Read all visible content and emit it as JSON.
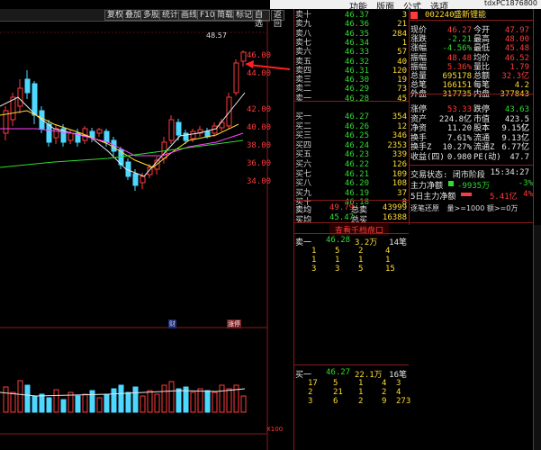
{
  "menu": {
    "items": [
      "功能",
      "版面",
      "公式",
      "选项"
    ],
    "device_id": "tdxPC1876800"
  },
  "toolbar": {
    "buttons": [
      "复权",
      "叠加",
      "多股",
      "统计",
      "画线",
      "F10",
      "简载",
      "标记",
      "自选",
      "返回"
    ]
  },
  "chart": {
    "price_labels": [
      "46.00",
      "44.00",
      "42.00",
      "40.00",
      "38.00",
      "36.00",
      "34.00"
    ],
    "high_marker": "48.57",
    "markers": [
      "财",
      "涨停"
    ],
    "volume_unit": "X100",
    "colors": {
      "up": "#ff3b3b",
      "down": "#4fd8ff",
      "ma5": "#e8e8e8",
      "ma10": "#ffdd33",
      "ma20": "#ff44ff",
      "ma60": "#2fdc2f"
    }
  },
  "orderbook": {
    "asks": [
      {
        "label": "卖十",
        "price": "46.37",
        "vol": "3"
      },
      {
        "label": "卖九",
        "price": "46.36",
        "vol": "21"
      },
      {
        "label": "卖八",
        "price": "46.35",
        "vol": "284"
      },
      {
        "label": "卖七",
        "price": "46.34",
        "vol": "1"
      },
      {
        "label": "卖六",
        "price": "46.33",
        "vol": "57"
      },
      {
        "label": "卖五",
        "price": "46.32",
        "vol": "40"
      },
      {
        "label": "卖四",
        "price": "46.31",
        "vol": "120"
      },
      {
        "label": "卖三",
        "price": "46.30",
        "vol": "19"
      },
      {
        "label": "卖二",
        "price": "46.29",
        "vol": "73"
      },
      {
        "label": "卖一",
        "price": "46.28",
        "vol": "45"
      }
    ],
    "bids": [
      {
        "label": "买一",
        "price": "46.27",
        "vol": "354"
      },
      {
        "label": "买二",
        "price": "46.26",
        "vol": "12"
      },
      {
        "label": "买三",
        "price": "46.25",
        "vol": "346"
      },
      {
        "label": "买四",
        "price": "46.24",
        "vol": "2353"
      },
      {
        "label": "买五",
        "price": "46.23",
        "vol": "339"
      },
      {
        "label": "买六",
        "price": "46.22",
        "vol": "126"
      },
      {
        "label": "买七",
        "price": "46.21",
        "vol": "109"
      },
      {
        "label": "买八",
        "price": "46.20",
        "vol": "108"
      },
      {
        "label": "买九",
        "price": "46.19",
        "vol": "37"
      },
      {
        "label": "买十",
        "price": "46.18",
        "vol": "8"
      }
    ],
    "avg_sell": {
      "label": "卖均",
      "price": "49.79",
      "total_label": "总卖",
      "total": "43999"
    },
    "avg_buy": {
      "label": "买均",
      "price": "45.47",
      "total_label": "总买",
      "total": "16388"
    }
  },
  "quote": {
    "code": "002240",
    "name": "盛新锂能",
    "rows": [
      {
        "l1": "现价",
        "v1": "46.27",
        "l2": "今开",
        "v2": "47.97"
      },
      {
        "l1": "涨跌",
        "v1": "-2.21",
        "l2": "最高",
        "v2": "48.00"
      },
      {
        "l1": "涨幅",
        "v1": "-4.56%",
        "l2": "最低",
        "v2": "45.48"
      },
      {
        "l1": "振幅",
        "v1": "48.48",
        "l2": "均价",
        "v2": "46.52"
      },
      {
        "l1": "振幅",
        "v1": "5.36%",
        "l2": "量比",
        "v2": "1.79"
      },
      {
        "l1": "总量",
        "v1": "695178",
        "l2": "总额",
        "v2": "32.3亿"
      },
      {
        "l1": "总笔",
        "v1": "166151",
        "l2": "每笔",
        "v2": "4.2"
      },
      {
        "l1": "外盘",
        "v1": "317735",
        "l2": "内盘",
        "v2": "377843"
      },
      {
        "l1": "涨停",
        "v1": "53.33",
        "l2": "跌停",
        "v2": "43.63"
      },
      {
        "l1": "资产",
        "v1": "224.8亿",
        "l2": "市值",
        "v2": "423.5亿"
      },
      {
        "l1": "净资",
        "v1": "11.20",
        "l2": "股本",
        "v2": "9.15亿"
      },
      {
        "l1": "换手",
        "v1": "7.61%",
        "l2": "流通",
        "v2": "9.13亿"
      },
      {
        "l1": "换手Z",
        "v1": "10.27%",
        "l2": "流通Z",
        "v2": "6.77亿"
      },
      {
        "l1": "收益(四)",
        "v1": "0.980",
        "l2": "PE(动)",
        "v2": "47.7"
      }
    ],
    "status": "交易状态: 闭市阶段",
    "time": "15:34:27",
    "main_flow_label": "主力净额",
    "main_flow_value": "-9935万",
    "main_flow_pct": "-3%",
    "main_flow5_label": "5日主力净额",
    "main_flow5_value": "5.41亿",
    "main_flow5_pct": "4%"
  },
  "trade_box": {
    "label": "查看千档盘口",
    "level_header": "逐笔还原",
    "filter": "量>=1000 额>=0万"
  },
  "sell_queue": {
    "label": "卖一",
    "price": "46.28",
    "vol": "3.2万",
    "count": "14笔",
    "rows": [
      [
        "1",
        "5",
        "2",
        "4"
      ],
      [
        "1",
        "1",
        "1",
        "1"
      ],
      [
        "3",
        "3",
        "5",
        "15"
      ]
    ]
  },
  "buy_queue": {
    "label": "买一",
    "price": "46.27",
    "vol": "22.1万",
    "count": "16笔",
    "rows": [
      [
        "17",
        "5",
        "1",
        "4",
        "3"
      ],
      [
        "2",
        "21",
        "1",
        "2",
        "4"
      ],
      [
        "3",
        "6",
        "2",
        "9",
        "273"
      ]
    ]
  }
}
